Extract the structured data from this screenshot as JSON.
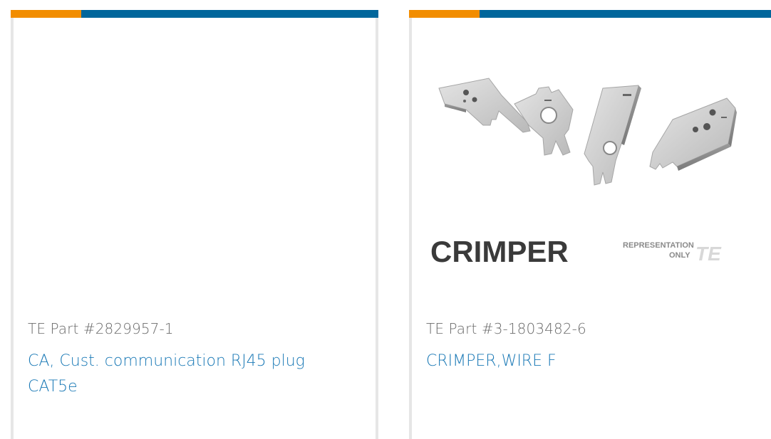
{
  "cards": [
    {
      "part_number": "TE Part #2829957-1",
      "description": "CA, Cust. communication RJ45 plug CAT5e",
      "has_image": false
    },
    {
      "part_number": "TE Part #3-1803482-6",
      "description": "CRIMPER,WIRE F",
      "has_image": true,
      "image": {
        "caption": "CRIMPER",
        "note_line1": "REPRESENTATION",
        "note_line2": "ONLY",
        "watermark": "TE"
      }
    }
  ],
  "colors": {
    "accent_orange": "#f28d00",
    "accent_blue": "#00669b",
    "link": "#1a79b6",
    "part_text": "#6b6b6b",
    "card_border": "#e6e6e6"
  }
}
